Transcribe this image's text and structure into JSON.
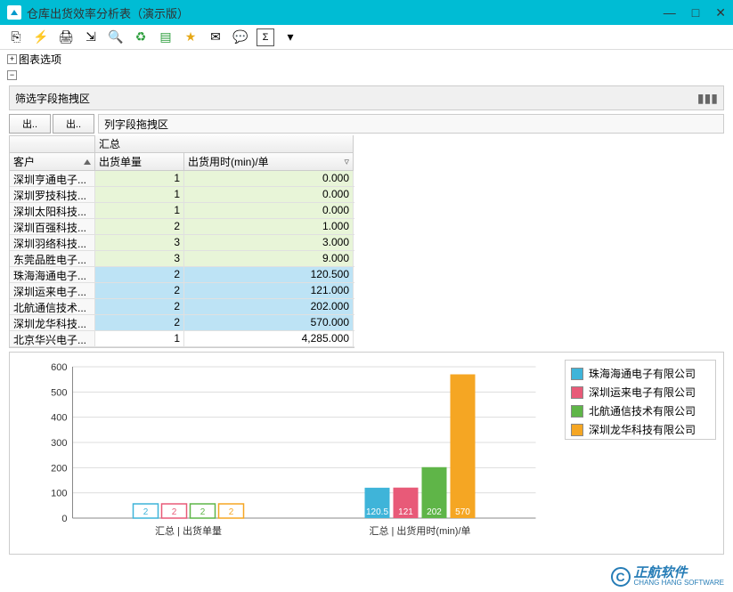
{
  "window": {
    "title": "仓库出货效率分析表（演示版）"
  },
  "tree": {
    "chart_options": "图表选项"
  },
  "filter_zone": "筛选字段拖拽区",
  "row_buttons": {
    "b1": "出..",
    "b2": "出.."
  },
  "col_drag": "列字段拖拽区",
  "headers": {
    "customer": "客户",
    "total": "汇总",
    "qty": "出货单量",
    "time": "出货用时(min)/单"
  },
  "rows": [
    {
      "cust": "深圳亨通电子...",
      "qty": "1",
      "time": "0.000",
      "cls": "green"
    },
    {
      "cust": "深圳罗技科技...",
      "qty": "1",
      "time": "0.000",
      "cls": "green"
    },
    {
      "cust": "深圳太阳科技...",
      "qty": "1",
      "time": "0.000",
      "cls": "green"
    },
    {
      "cust": "深圳百强科技...",
      "qty": "2",
      "time": "1.000",
      "cls": "green"
    },
    {
      "cust": "深圳羽络科技...",
      "qty": "3",
      "time": "3.000",
      "cls": "green"
    },
    {
      "cust": "东莞品胜电子...",
      "qty": "3",
      "time": "9.000",
      "cls": "green"
    },
    {
      "cust": "珠海海通电子...",
      "qty": "2",
      "time": "120.500",
      "cls": "blue"
    },
    {
      "cust": "深圳运来电子...",
      "qty": "2",
      "time": "121.000",
      "cls": "blue"
    },
    {
      "cust": "北航通信技术...",
      "qty": "2",
      "time": "202.000",
      "cls": "blue"
    },
    {
      "cust": "深圳龙华科技...",
      "qty": "2",
      "time": "570.000",
      "cls": "blue"
    },
    {
      "cust": "北京华兴电子...",
      "qty": "1",
      "time": "4,285.000",
      "cls": "white"
    }
  ],
  "legend": [
    {
      "name": "珠海海通电子有限公司",
      "color": "#3fb4d9"
    },
    {
      "name": "深圳运来电子有限公司",
      "color": "#e85a78"
    },
    {
      "name": "北航通信技术有限公司",
      "color": "#5fb548"
    },
    {
      "name": "深圳龙华科技有限公司",
      "color": "#f5a623"
    }
  ],
  "chart_data": {
    "type": "bar",
    "x_groups": [
      "汇总 | 出货单量",
      "汇总 | 出货用时(min)/单"
    ],
    "ylim": [
      0,
      600
    ],
    "yticks": [
      0,
      100,
      200,
      300,
      400,
      500,
      600
    ],
    "series": [
      {
        "name": "珠海海通电子有限公司",
        "color": "#3fb4d9",
        "values": [
          2,
          120.5
        ]
      },
      {
        "name": "深圳运来电子有限公司",
        "color": "#e85a78",
        "values": [
          2,
          121
        ]
      },
      {
        "name": "北航通信技术有限公司",
        "color": "#5fb548",
        "values": [
          2,
          202
        ]
      },
      {
        "name": "深圳龙华科技有限公司",
        "color": "#f5a623",
        "values": [
          2,
          570
        ]
      }
    ]
  },
  "watermark": {
    "letter": "C",
    "text1": "正航软件",
    "text2": "CHANG HANG SOFTWARE"
  }
}
